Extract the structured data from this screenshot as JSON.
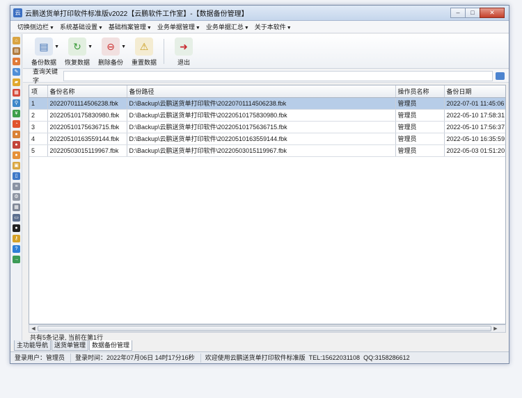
{
  "window": {
    "title": "云鹏送货单打印软件标准版v2022【云鹏软件工作室】-【数据备份管理】",
    "controls": [
      "–",
      "□",
      "✕"
    ]
  },
  "menu": {
    "items": [
      "切换侧边栏",
      "系统基础设置",
      "基础档案管理",
      "业务单据管理",
      "业务单据汇总",
      "关于本软件"
    ]
  },
  "toolbar": {
    "buttons": [
      {
        "label": "备份数据",
        "icon": "database-backup-icon"
      },
      {
        "label": "恢复数据",
        "icon": "restore-icon"
      },
      {
        "label": "删除备份",
        "icon": "delete-backup-icon"
      },
      {
        "label": "重置数据",
        "icon": "reset-data-icon"
      },
      {
        "label": "退出",
        "icon": "exit-icon"
      }
    ]
  },
  "search": {
    "label": "查询关键字",
    "value": ""
  },
  "table": {
    "columns": [
      "项",
      "备份名称",
      "备份路径",
      "操作员名称",
      "备份日期"
    ],
    "rows": [
      [
        "1",
        "20220701114506238.fbk",
        "D:\\Backup\\云鹏送货单打印软件\\20220701114506238.fbk",
        "管理员",
        "2022-07-01 11:45:06"
      ],
      [
        "2",
        "20220510175830980.fbk",
        "D:\\Backup\\云鹏送货单打印软件\\20220510175830980.fbk",
        "管理员",
        "2022-05-10 17:58:31"
      ],
      [
        "3",
        "20220510175636715.fbk",
        "D:\\Backup\\云鹏送货单打印软件\\20220510175636715.fbk",
        "管理员",
        "2022-05-10 17:56:37"
      ],
      [
        "4",
        "20220510163559144.fbk",
        "D:\\Backup\\云鹏送货单打印软件\\20220510163559144.fbk",
        "管理员",
        "2022-05-10 16:35:59"
      ],
      [
        "5",
        "20220503015119967.fbk",
        "D:\\Backup\\云鹏送货单打印软件\\20220503015119967.fbk",
        "管理员",
        "2022-05-03 01:51:20"
      ]
    ],
    "selected_row": 1
  },
  "record_status": "共有5条记录, 当前在第1行",
  "tabs": [
    "主功能导航",
    "送货单管理",
    "数据备份管理"
  ],
  "active_tab": "数据备份管理",
  "footer": {
    "user_label": "登录用户：",
    "user": "管理员",
    "time_label": "登录时间：",
    "time": "2022年07月06日 14时17分16秒",
    "welcome": "欢迎使用云鹏送货单打印软件标准版",
    "tel": "TEL:15622031108",
    "qq": "QQ:3158286612"
  },
  "colors": {
    "selection": "#b7cde8",
    "titlebar": "#c5d6ec"
  }
}
